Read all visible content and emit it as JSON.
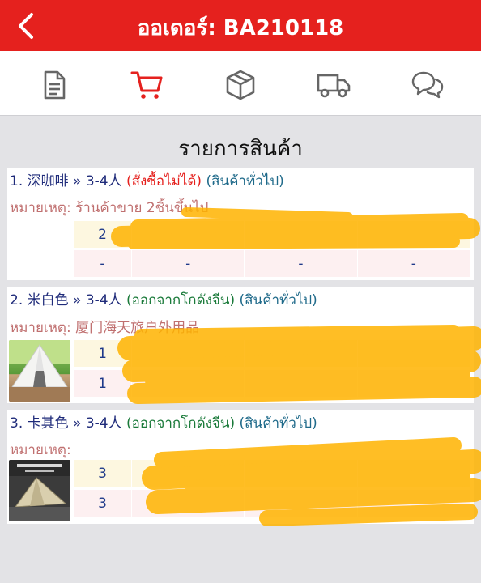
{
  "header": {
    "title": "ออเดอร์: BA210118",
    "back_icon": "chevron-left-icon"
  },
  "tabs": [
    {
      "icon": "document-icon",
      "active": false
    },
    {
      "icon": "cart-icon",
      "active": true
    },
    {
      "icon": "package-icon",
      "active": false
    },
    {
      "icon": "truck-icon",
      "active": false
    },
    {
      "icon": "chat-icon",
      "active": false
    }
  ],
  "section": {
    "title": "รายการสินค้า"
  },
  "items": [
    {
      "title": "1. 深咖啡 » 3-4人",
      "status": "(สั่งซื้อไม่ได้)",
      "category": "(สินค้าทั่วไป)",
      "note": "หมายเหตุ: ร้านค้าขาย 2ชิ้นขึ้นไป",
      "row1": [
        "2"
      ],
      "row2": [
        "-",
        "-",
        "-",
        "-"
      ]
    },
    {
      "title": "2. 米白色 » 3-4人",
      "status": "(ออกจากโกดังจีน)",
      "category": "(สินค้าทั่วไป)",
      "note": "หมายเหตุ: 厦门海天旅户外用品",
      "row1": [
        "1"
      ],
      "row2": [
        "1"
      ]
    },
    {
      "title": "3. 卡其色 » 3-4人",
      "status": "(ออกจากโกดังจีน)",
      "category": "(สินค้าทั่วไป)",
      "note": "หมายเหตุ:",
      "row1": [
        "3"
      ],
      "row2": [
        "3"
      ]
    }
  ],
  "colors": {
    "brand": "#e5211e",
    "highlight": "#ffb300"
  }
}
